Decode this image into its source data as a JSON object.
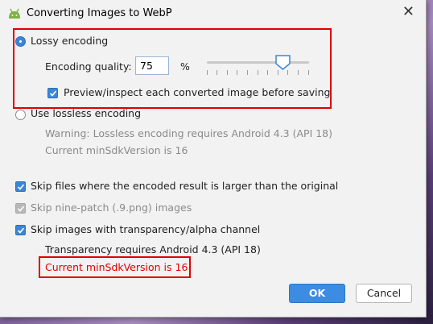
{
  "window": {
    "title": "Converting Images to WebP",
    "close_glyph": "✕"
  },
  "lossy": {
    "label": "Lossy encoding",
    "selected": true,
    "quality_label": "Encoding quality:",
    "quality_value": "75",
    "percent": "%",
    "quality_level": 75,
    "preview_label": "Preview/inspect each converted image before saving",
    "preview_checked": true
  },
  "lossless": {
    "label": "Use lossless encoding",
    "selected": false,
    "warning": "Warning: Lossless encoding requires Android 4.3 (API 18)",
    "min_sdk": "Current minSdkVersion is 16"
  },
  "options": {
    "skip_larger": "Skip files where the encoded result is larger than the original",
    "skip_nine_patch": "Skip nine-patch (.9.png) images",
    "skip_alpha": "Skip images with transparency/alpha channel",
    "alpha_note": "Transparency requires Android 4.3 (API 18)",
    "alpha_min_sdk": "Current minSdkVersion is 16"
  },
  "buttons": {
    "ok": "OK",
    "cancel": "Cancel"
  },
  "colors": {
    "accent": "#3b86d6",
    "highlight": "#e00000",
    "android_green": "#7cb342"
  },
  "icons": {
    "app": "android-icon",
    "close": "close-icon",
    "check": "checkmark-icon"
  }
}
